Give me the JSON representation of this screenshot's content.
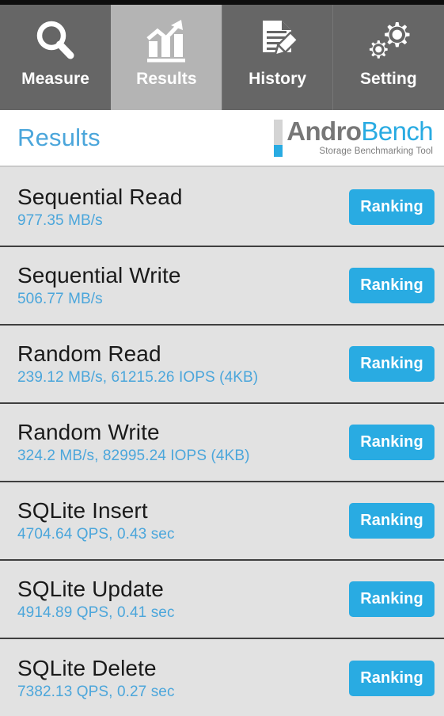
{
  "window": {
    "app_title": "AndroBench",
    "status_strip_color": "#0d0d0d"
  },
  "tabbar": {
    "active_tab": "Results",
    "active_bg": "#b4b4b4",
    "inactive_bg": "#666666",
    "tabs": [
      {
        "label": "Measure",
        "icon": "magnifier-icon",
        "active": false
      },
      {
        "label": "Results",
        "icon": "bar-chart-icon",
        "active": true
      },
      {
        "label": "History",
        "icon": "document-pencil-icon",
        "active": false
      },
      {
        "label": "Setting",
        "icon": "gears-icon",
        "active": false
      }
    ]
  },
  "header": {
    "title": "Results",
    "title_color": "#4ba6db",
    "brand": {
      "part1": "Andro",
      "part2": "Bench",
      "part1_color": "#777777",
      "part2_color": "#29abe2",
      "tagline": "Storage Benchmarking Tool"
    }
  },
  "results": {
    "accent_color": "#29abe2",
    "value_color": "#4ba6db",
    "row_bg": "#e2e2e2",
    "rows": [
      {
        "name": "Sequential Read",
        "value": "977.35 MB/s",
        "button": "Ranking"
      },
      {
        "name": "Sequential Write",
        "value": "506.77 MB/s",
        "button": "Ranking"
      },
      {
        "name": "Random Read",
        "value": "239.12 MB/s, 61215.26 IOPS (4KB)",
        "button": "Ranking"
      },
      {
        "name": "Random Write",
        "value": "324.2 MB/s, 82995.24 IOPS (4KB)",
        "button": "Ranking"
      },
      {
        "name": "SQLite Insert",
        "value": "4704.64 QPS, 0.43 sec",
        "button": "Ranking"
      },
      {
        "name": "SQLite Update",
        "value": "4914.89 QPS, 0.41 sec",
        "button": "Ranking"
      },
      {
        "name": "SQLite Delete",
        "value": "7382.13 QPS, 0.27 sec",
        "button": "Ranking"
      }
    ]
  }
}
